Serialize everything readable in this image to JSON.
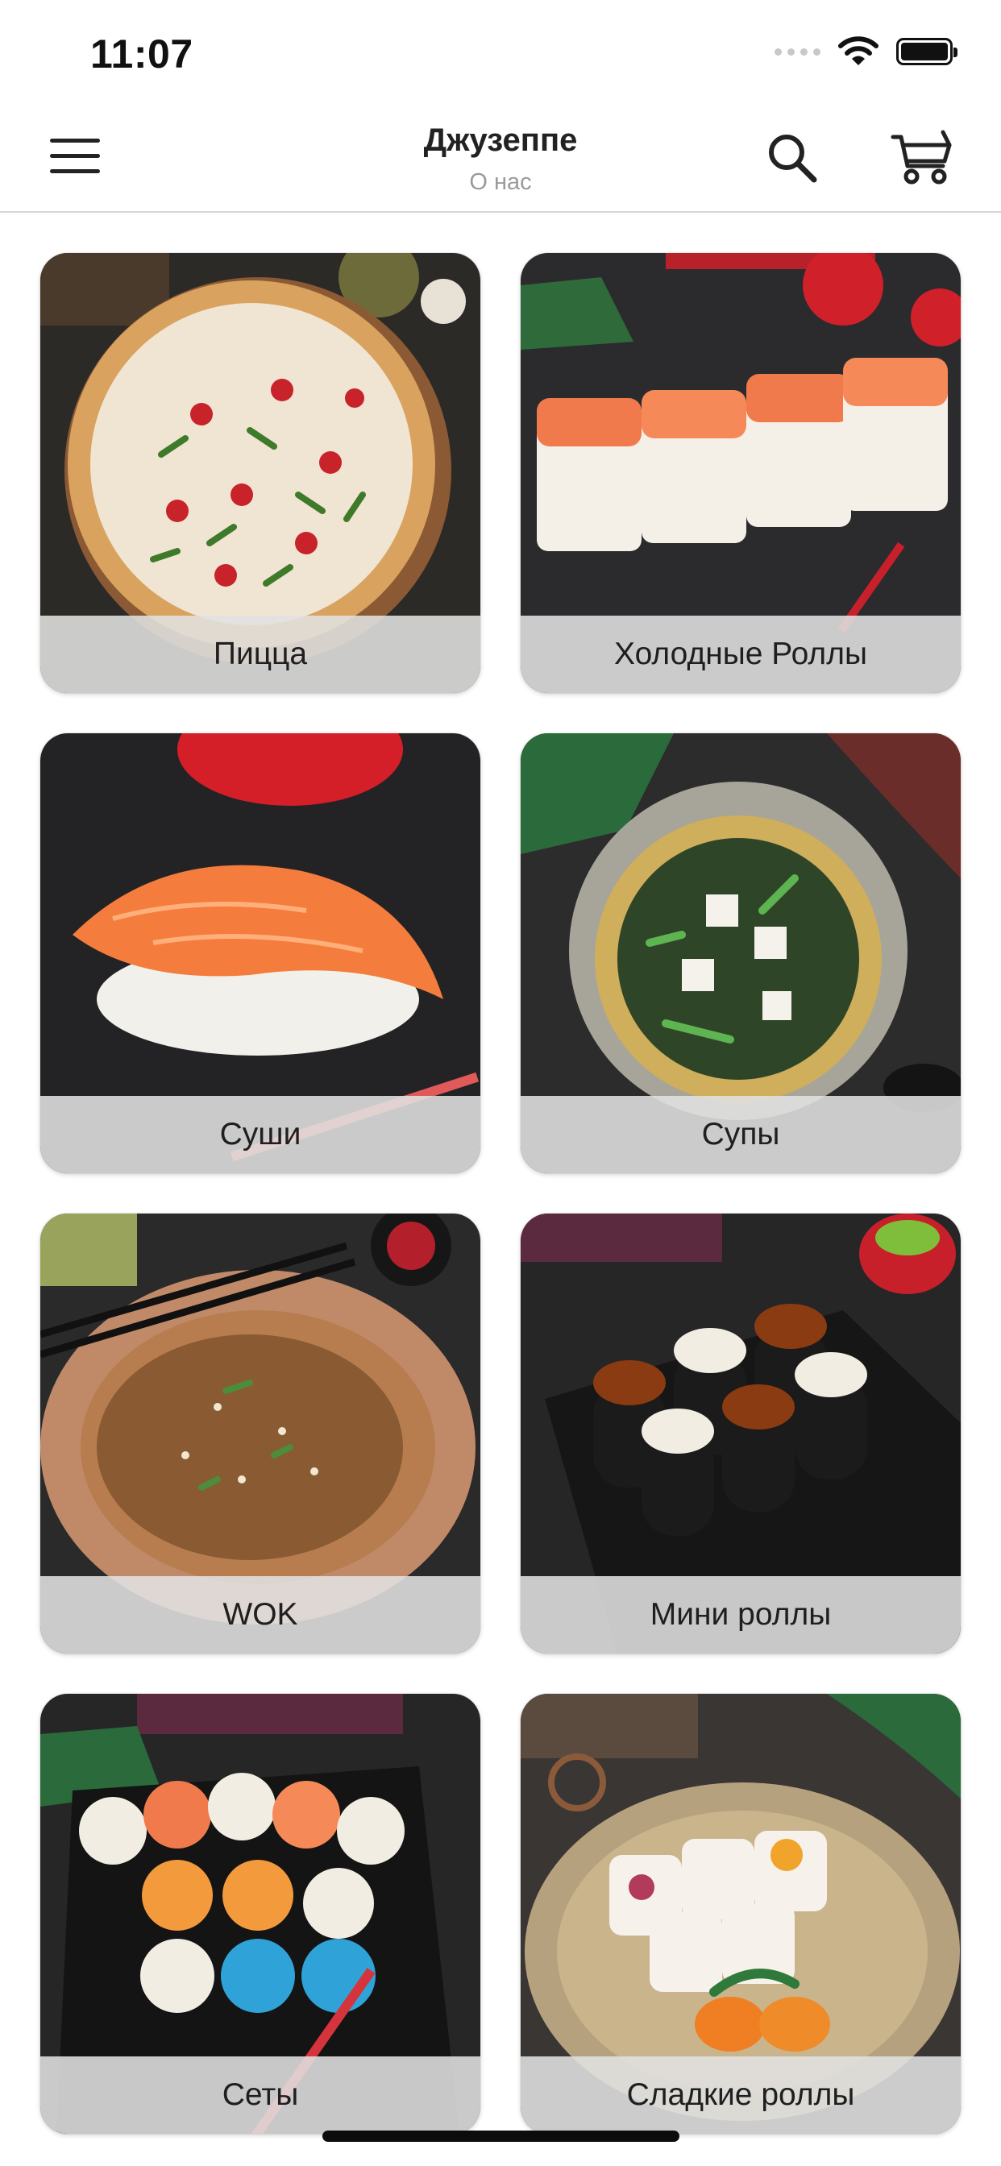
{
  "status_bar": {
    "time": "11:07"
  },
  "header": {
    "title": "Джузеппе",
    "subtitle": "О нас",
    "menu_icon": "hamburger-menu-icon",
    "search_icon": "search-icon",
    "cart_icon": "shopping-cart-icon"
  },
  "categories": [
    {
      "label": "Пицца",
      "theme": "pizza"
    },
    {
      "label": "Холодные Роллы",
      "theme": "cold-rolls"
    },
    {
      "label": "Суши",
      "theme": "sushi"
    },
    {
      "label": "Супы",
      "theme": "soup"
    },
    {
      "label": "WOK",
      "theme": "wok"
    },
    {
      "label": "Мини роллы",
      "theme": "mini-rolls"
    },
    {
      "label": "Сеты",
      "theme": "sets"
    },
    {
      "label": "Сладкие роллы",
      "theme": "sweet-rolls"
    }
  ]
}
